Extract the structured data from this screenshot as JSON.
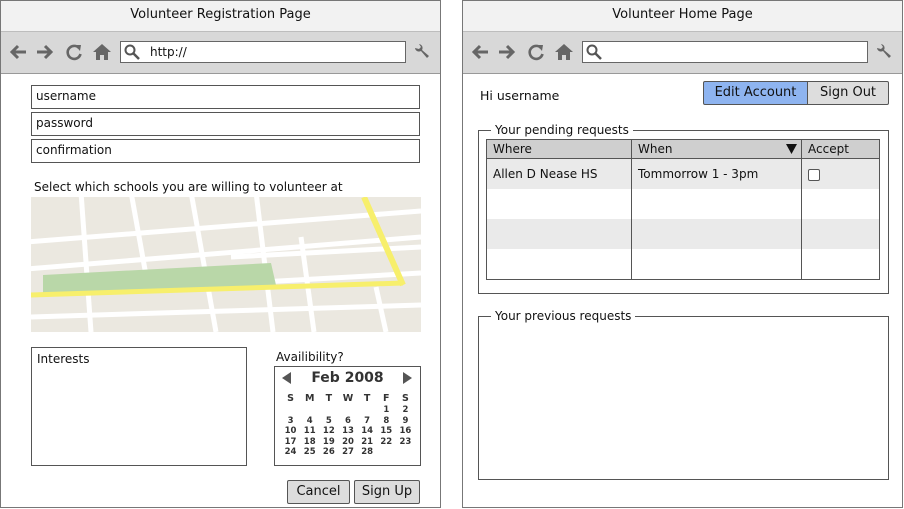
{
  "registration": {
    "title": "Volunteer Registration Page",
    "url": "http://",
    "fields": {
      "username": "username",
      "password": "password",
      "confirmation": "confirmation"
    },
    "map_label": "Select which schools you are willing to volunteer at",
    "interests_label": "Interests",
    "availability_label": "Availibility?",
    "calendar": {
      "month_label": "Feb 2008",
      "weekdays": [
        "S",
        "M",
        "T",
        "W",
        "T",
        "F",
        "S"
      ],
      "weeks": [
        [
          "",
          "",
          "",
          "",
          "",
          "1",
          "2"
        ],
        [
          "3",
          "4",
          "5",
          "6",
          "7",
          "8",
          "9"
        ],
        [
          "10",
          "11",
          "12",
          "13",
          "14",
          "15",
          "16"
        ],
        [
          "17",
          "18",
          "19",
          "20",
          "21",
          "22",
          "23"
        ],
        [
          "24",
          "25",
          "26",
          "27",
          "28",
          "",
          ""
        ]
      ]
    },
    "cancel_label": "Cancel",
    "signup_label": "Sign Up"
  },
  "home": {
    "title": "Volunteer Home Page",
    "url": "",
    "greeting": "Hi username",
    "edit_account_label": "Edit Account",
    "sign_out_label": "Sign Out",
    "pending_legend": "Your pending requests",
    "columns": [
      "Where",
      "When",
      "Accept"
    ],
    "rows": [
      {
        "where": "Allen D Nease HS",
        "when": "Tommorrow 1 - 3pm",
        "accept": false
      }
    ],
    "previous_legend": "Your previous requests"
  },
  "colors": {
    "toolbar_bg": "#d8d8d8",
    "selected_button": "#8eb4f0",
    "map_road_yellow": "#f7ef6c",
    "map_park_green": "#b9d7a8",
    "map_bg": "#ebe8e0"
  },
  "icons": [
    "back-arrow-icon",
    "forward-arrow-icon",
    "reload-icon",
    "home-icon",
    "search-icon",
    "wrench-icon"
  ]
}
